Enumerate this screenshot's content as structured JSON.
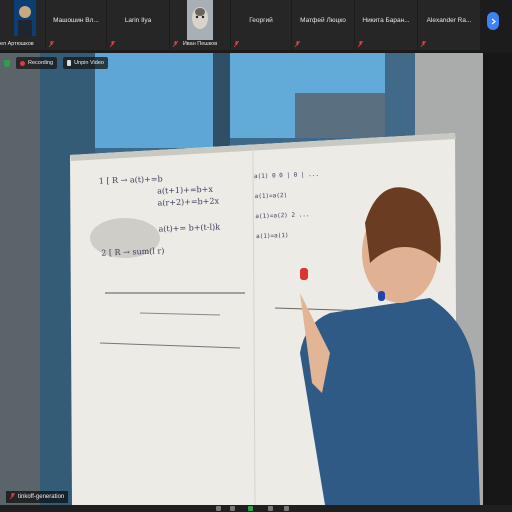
{
  "participants": [
    {
      "id": "p1",
      "name": "ел Артюшков",
      "has_photo": true,
      "muted": false
    },
    {
      "id": "p2",
      "name": "Машошин Вл...",
      "muted": true
    },
    {
      "id": "p3",
      "name": "Larin Ilya",
      "muted": true
    },
    {
      "id": "p4",
      "name": "Иван Пешков",
      "has_photo": true,
      "muted": true
    },
    {
      "id": "p5",
      "name": "Георгий",
      "muted": true
    },
    {
      "id": "p6",
      "name": "Матфей Люцко",
      "muted": true
    },
    {
      "id": "p7",
      "name": "Никита Баран...",
      "muted": true
    },
    {
      "id": "p8",
      "name": "Alexander Ra...",
      "muted": true
    }
  ],
  "toolbar": {
    "recording_label": "Recording",
    "unpin_label": "Unpin Video"
  },
  "speaker": {
    "name": "tinkoff-generation"
  },
  "whiteboard": {
    "left_lines": [
      "1 [ R → a(t)+=b",
      "a(t+1)+=b+x",
      "a(r+2)+=b+2x",
      "a(t)+= b+(t-l)k",
      "2 [ R → sum(l r)"
    ],
    "right_lines": [
      "a(1) 0 0 |  0 | ...",
      "a(1)=a(2)",
      "a(1)=a(2) 2 ...",
      "a(1)=a(1)"
    ]
  },
  "colors": {
    "accent": "#3b82f6",
    "record": "#e23a3a",
    "muted_mic": "#e04545",
    "shield": "#2e9e4f"
  }
}
